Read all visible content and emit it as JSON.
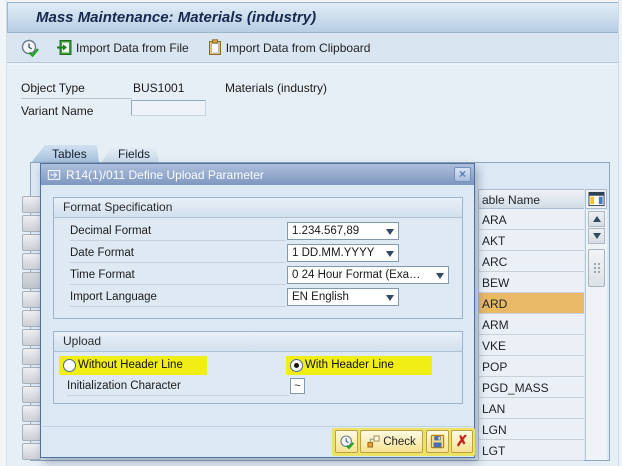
{
  "window": {
    "title": "Mass Maintenance: Materials (industry)"
  },
  "toolbar": {
    "import_file": "Import Data from File",
    "import_clipboard": "Import Data from Clipboard"
  },
  "fields": {
    "object_type_label": "Object Type",
    "object_type_value": "BUS1001",
    "object_type_desc": "Materials (industry)",
    "variant_label": "Variant Name",
    "variant_value": ""
  },
  "tabs": {
    "tables": "Tables",
    "fields": "Fields"
  },
  "dialog": {
    "title": "R14(1)/011 Define Upload Parameter",
    "close_glyph": "×",
    "format_section": {
      "title": "Format Specification",
      "rows": [
        {
          "label": "Decimal Format",
          "value": "1.234.567,89"
        },
        {
          "label": "Date Format",
          "value": "1 DD.MM.YYYY"
        },
        {
          "label": "Time Format",
          "value": "0 24 Hour Format (Exa…"
        },
        {
          "label": "Import Language",
          "value": "EN English"
        }
      ]
    },
    "upload_section": {
      "title": "Upload",
      "without_header_label": "Without Header Line",
      "with_header_label": "With Header Line",
      "selected_option": "With Header Line",
      "init_char_label": "Initialization Character",
      "init_char_value": "~"
    },
    "buttons": {
      "check": "Check"
    }
  },
  "table": {
    "header": "able Name",
    "rows": [
      "ARA",
      "AKT",
      "ARC",
      "BEW",
      "ARD",
      "ARM",
      "VKE",
      "POP",
      "PGD_MASS",
      "LAN",
      "LGN",
      "LGT"
    ],
    "selected": "ARD"
  },
  "colors": {
    "highlight_yellow": "#f0ee15",
    "selected_row_orange": "#e9b967",
    "dialog_titlebar_blue": "#8aa0c6",
    "footer_highlight": "#ece263"
  }
}
